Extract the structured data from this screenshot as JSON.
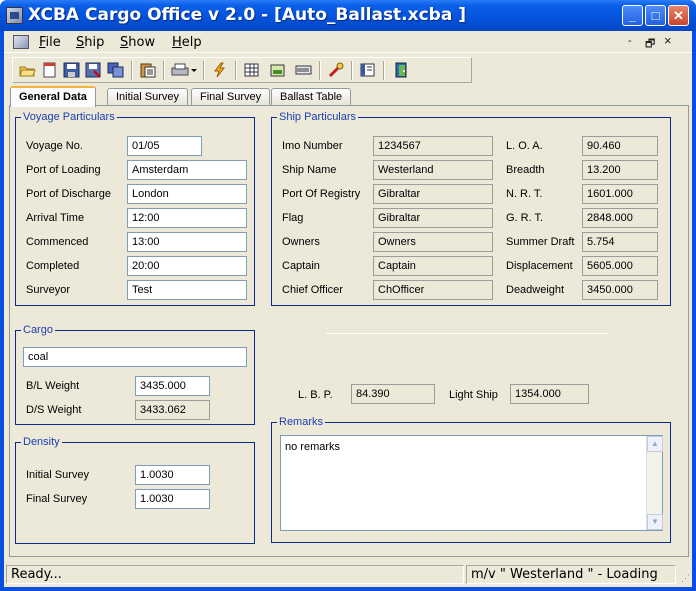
{
  "window": {
    "title": "XCBA Cargo Office v 2.0 - [Auto_Ballast.xcba ]",
    "min_glyph": "_",
    "max_glyph": "□",
    "close_glyph": "✕"
  },
  "menu": {
    "items": [
      {
        "first": "F",
        "rest": "ile"
      },
      {
        "first": "S",
        "rest": "hip"
      },
      {
        "first": "S",
        "rest": "how"
      },
      {
        "first": "H",
        "rest": "elp"
      }
    ],
    "mdi_min": "-",
    "mdi_restore": "🗗",
    "mdi_close": "×"
  },
  "toolbar": {
    "icons": [
      "open-folder-icon",
      "new-document-icon",
      "save-icon",
      "save-as-icon",
      "copy-icon",
      "paste-report-icon",
      "print-icon",
      "calculate-lightning-icon",
      "grid-table-icon",
      "tank-icon",
      "draft-icon",
      "tools-icon",
      "book-icon",
      "exit-door-icon"
    ]
  },
  "tabs": [
    "General Data",
    "Initial Survey",
    "Final Survey",
    "Ballast Table"
  ],
  "voyage": {
    "title": "Voyage Particulars",
    "rows": [
      {
        "label": "Voyage No.",
        "value": "01/05"
      },
      {
        "label": "Port of Loading",
        "value": "Amsterdam"
      },
      {
        "label": "Port of Discharge",
        "value": "London"
      },
      {
        "label": "Arrival Time",
        "value": "12:00"
      },
      {
        "label": "Commenced",
        "value": "13:00"
      },
      {
        "label": "Completed",
        "value": "20:00"
      },
      {
        "label": "Surveyor",
        "value": "Test"
      }
    ]
  },
  "ship": {
    "title": "Ship Particulars",
    "left": [
      {
        "label": "Imo Number",
        "value": "1234567"
      },
      {
        "label": "Ship Name",
        "value": "Westerland"
      },
      {
        "label": "Port Of Registry",
        "value": "Gibraltar"
      },
      {
        "label": "Flag",
        "value": "Gibraltar"
      },
      {
        "label": "Owners",
        "value": "Owners"
      },
      {
        "label": "Captain",
        "value": "Captain"
      },
      {
        "label": "Chief Officer",
        "value": "ChOfficer"
      }
    ],
    "right": [
      {
        "label": "L. O. A.",
        "value": "90.460"
      },
      {
        "label": "Breadth",
        "value": "13.200"
      },
      {
        "label": "N. R. T.",
        "value": "1601.000"
      },
      {
        "label": "G. R. T.",
        "value": "2848.000"
      },
      {
        "label": "Summer Draft",
        "value": "5.754"
      },
      {
        "label": "Displacement",
        "value": "5605.000"
      },
      {
        "label": "Deadweight",
        "value": "3450.000"
      }
    ]
  },
  "lbp": {
    "label": "L. B. P.",
    "value": "84.390"
  },
  "lightship": {
    "label": "Light Ship",
    "value": "1354.000"
  },
  "cargo": {
    "title": "Cargo",
    "name": "coal",
    "bl_label": "B/L Weight",
    "bl_value": "3435.000",
    "ds_label": "D/S Weight",
    "ds_value": "3433.062"
  },
  "density": {
    "title": "Density",
    "initial_label": "Initial Survey",
    "initial_value": "1.0030",
    "final_label": "Final Survey",
    "final_value": "1.0030"
  },
  "remarks": {
    "title": "Remarks",
    "text": "no remarks"
  },
  "status": {
    "left": "Ready...",
    "right": "m/v  \" Westerland \" - Loading"
  }
}
